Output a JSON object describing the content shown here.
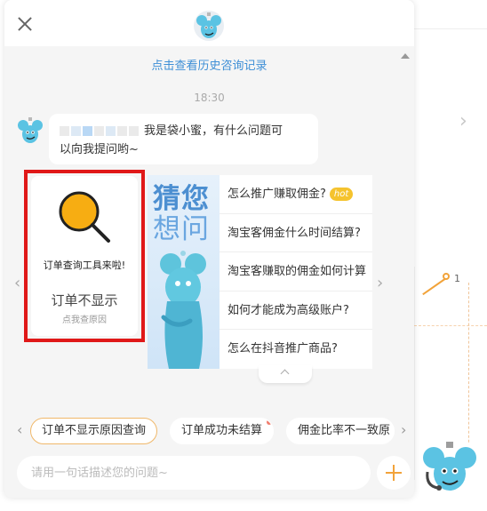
{
  "header": {
    "close_icon": "close-icon",
    "avatar_icon": "mascot-avatar-icon"
  },
  "history_link": "点击查看历史咨询记录",
  "time_label": "18:30",
  "greeting": {
    "text_line1": "我是袋小蜜，有什么问题可",
    "text_line2": "以向我提问哟~"
  },
  "tool_card": {
    "title": "订单查询工具来啦!",
    "subtitle": "订单不显示",
    "hint": "点我查原因",
    "icon": "magnifier-icon",
    "highlight_color": "#e01818"
  },
  "faq_card": {
    "image_title1": "猜您",
    "image_title2": "想问",
    "items": [
      {
        "text": "怎么推广赚取佣金?",
        "badge": "hot"
      },
      {
        "text": "淘宝客佣金什么时间结算?"
      },
      {
        "text": "淘宝客赚取的佣金如何计算"
      },
      {
        "text": "如何才能成为高级账户?"
      },
      {
        "text": "怎么在抖音推广商品?"
      }
    ]
  },
  "chips": [
    {
      "label": "订单不显示原因查询",
      "active": true
    },
    {
      "label": "订单成功未结算",
      "dot": true
    },
    {
      "label": "佣金比率不一致原"
    }
  ],
  "input": {
    "placeholder": "请用一句话描述您的问题~"
  },
  "background": {
    "point_label": "1",
    "accent_color": "#f2a33a"
  }
}
